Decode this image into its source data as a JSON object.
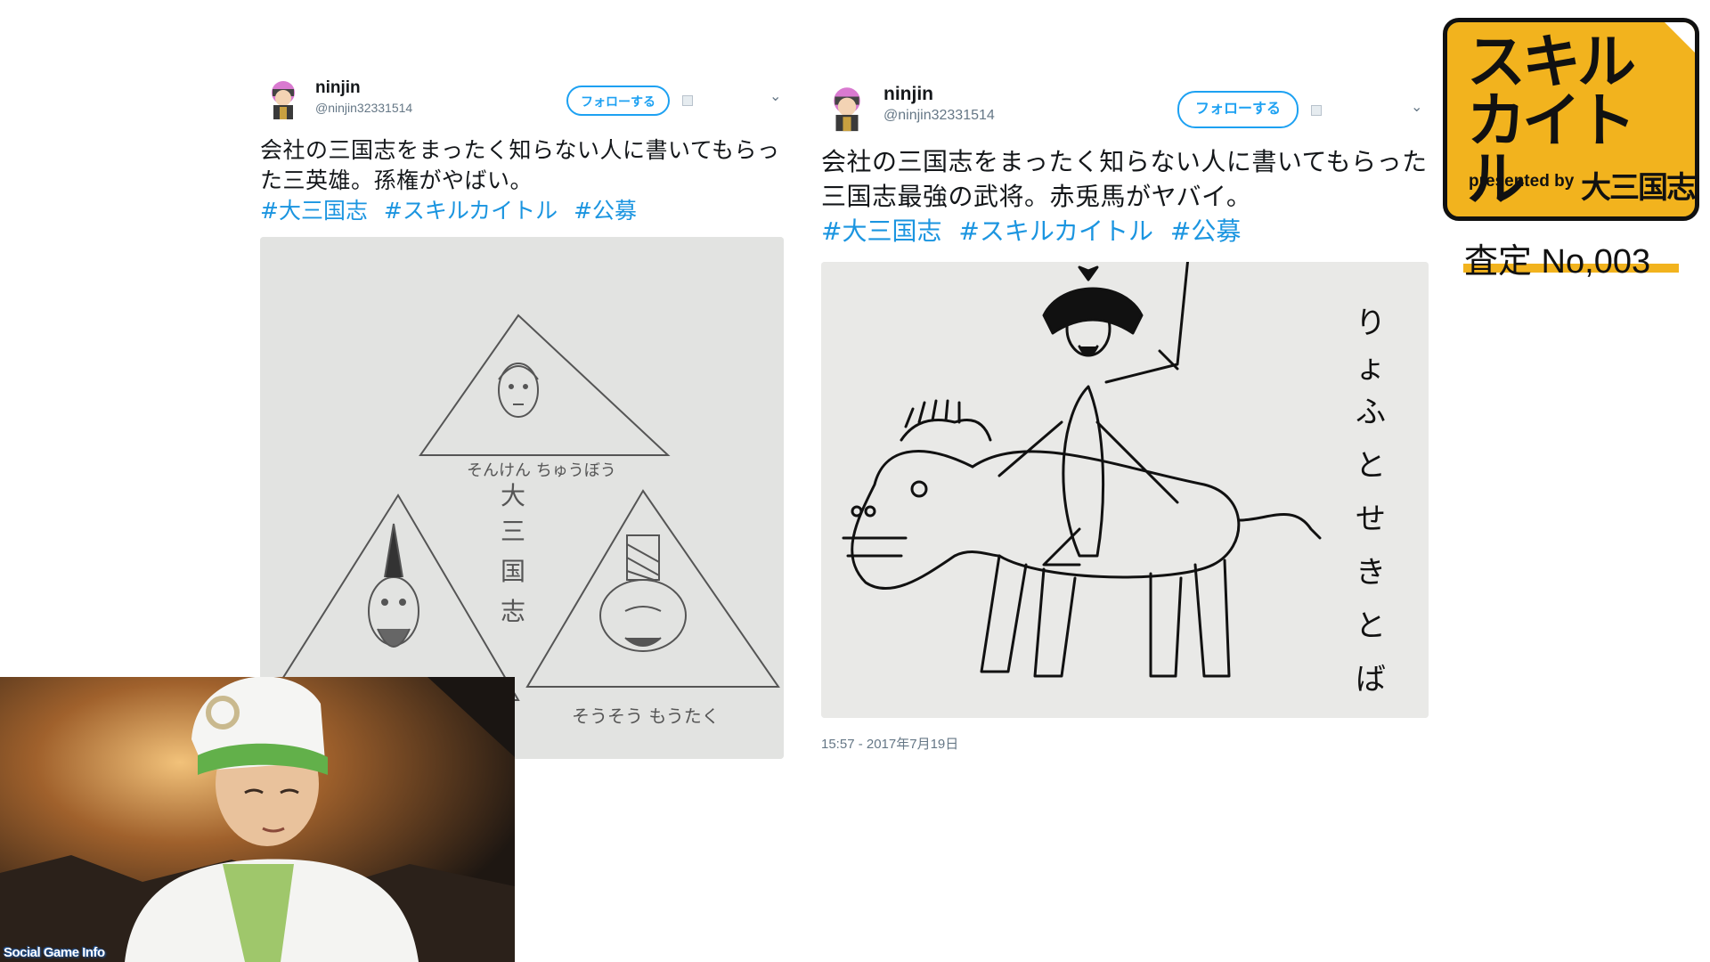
{
  "tweets": [
    {
      "display_name": "ninjin",
      "handle": "@ninjin32331514",
      "follow_label": "フォローする",
      "text": "会社の三国志をまったく知らない人に書いてもらった三英雄。孫権がやばい。",
      "hashtags": [
        "#大三国志",
        "#スキルカイトル",
        "#公募"
      ],
      "drawing_labels": [
        "そんけん ちゅうぼう",
        "大三国志",
        "そうそう もうたく"
      ]
    },
    {
      "display_name": "ninjin",
      "handle": "@ninjin32331514",
      "follow_label": "フォローする",
      "text": "会社の三国志をまったく知らない人に書いてもらった三国志最強の武将。赤兎馬がヤバイ。",
      "hashtags": [
        "#大三国志",
        "#スキルカイトル",
        "#公募"
      ],
      "drawing_labels": [
        "りょふとせきとば"
      ],
      "timestamp": "15:57 - 2017年7月19日"
    }
  ],
  "badge": {
    "title": "スキルカイトル",
    "presented_by": "presented by",
    "logo_text": "大三国志",
    "assessment": "査定 No,003",
    "color": "#f2b31e"
  },
  "webcam": {
    "watermark": "Social Game Info"
  },
  "colors": {
    "link": "#1b95e0",
    "follow": "#1da1f2"
  }
}
